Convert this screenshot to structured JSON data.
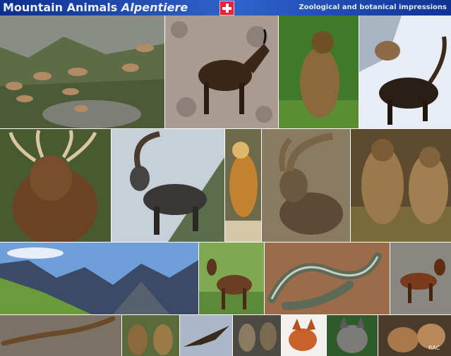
{
  "header": {
    "title_main": "Mountain Animals",
    "title_sub": "Alpentiere",
    "flag_icon": "swiss-flag-icon",
    "tagline": "Zoological and botanical impressions"
  },
  "footer": {
    "credit": "RAC"
  },
  "colors": {
    "header_dark": "#0d2f8f",
    "header_light": "#2e5fc7",
    "flag_red": "#e2243b"
  }
}
